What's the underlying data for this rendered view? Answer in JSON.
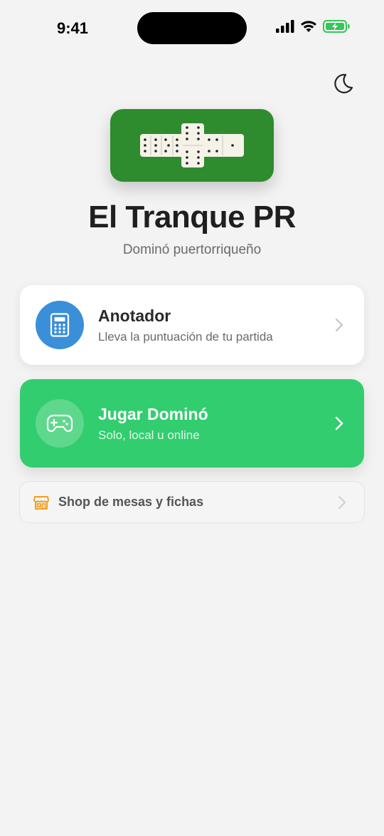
{
  "status_bar": {
    "time": "9:41"
  },
  "header": {
    "theme_toggle_icon": "moon-icon",
    "logo_icon": "domino-tiles-icon",
    "title": "El Tranque PR",
    "subtitle": "Dominó puertorriqueño"
  },
  "cards": {
    "anotador": {
      "title": "Anotador",
      "description": "Lleva la puntuación de tu partida",
      "icon": "calculator-icon",
      "icon_color": "#3a8fd8"
    },
    "jugar": {
      "title": "Jugar Dominó",
      "description": "Solo, local u online",
      "icon": "gamepad-icon",
      "background": "#32cd6f"
    }
  },
  "shop": {
    "label": "Shop de mesas y fichas",
    "icon": "store-icon",
    "icon_color": "#f0a020"
  },
  "colors": {
    "logo_background": "#2e8b2e",
    "page_background": "#f3f3f3"
  }
}
